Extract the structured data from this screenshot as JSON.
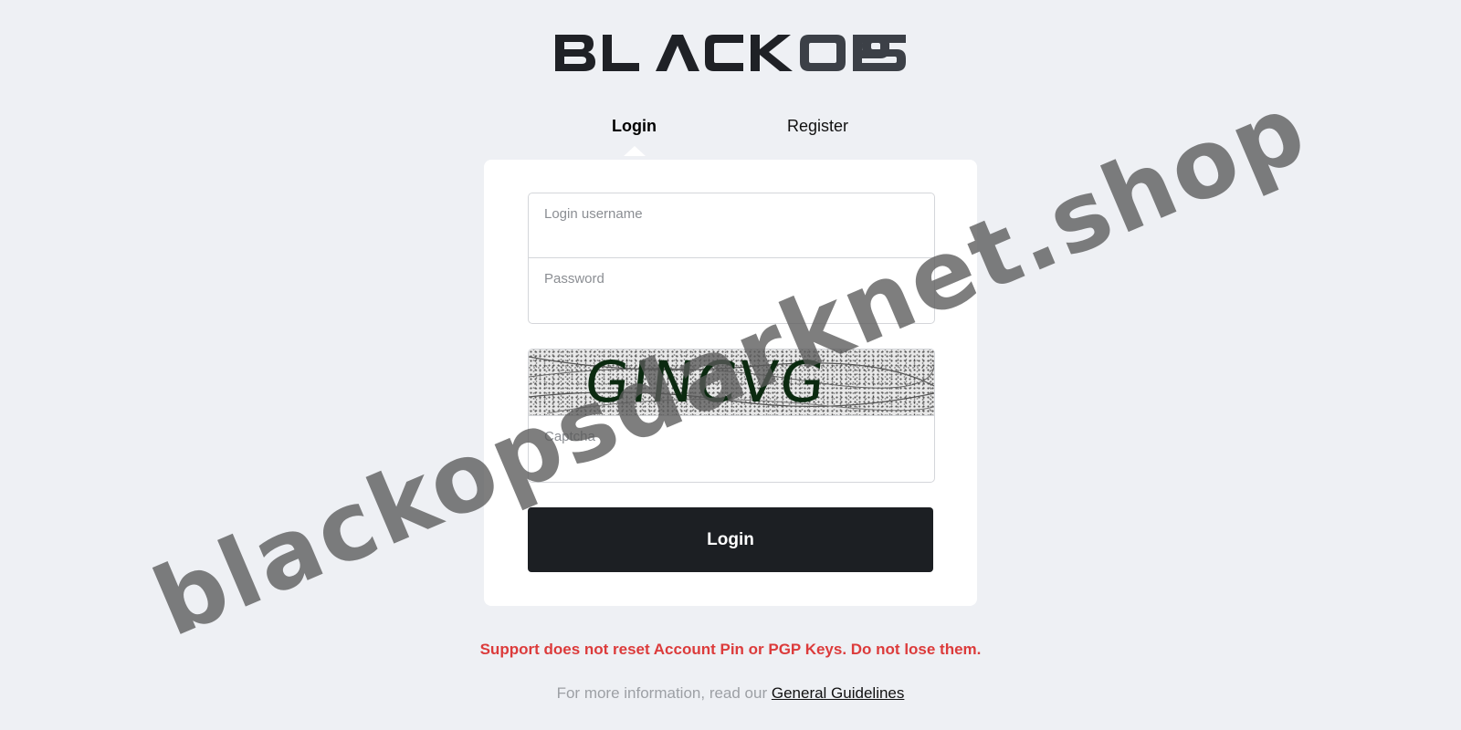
{
  "brand": {
    "name": "BLACK OPS",
    "logo_color": "#2a2c30"
  },
  "tabs": [
    {
      "label": "Login",
      "active": true
    },
    {
      "label": "Register",
      "active": false
    }
  ],
  "form": {
    "username_label": "Login username",
    "username_value": "",
    "password_label": "Password",
    "password_value": "",
    "captcha_image_text": "GINCVG",
    "captcha_label": "Captcha",
    "captcha_value": "",
    "submit_label": "Login"
  },
  "notices": {
    "warning": "Support does not reset Account Pin or PGP Keys. Do not lose them.",
    "info_prefix": "For more information, read our ",
    "info_link": "General Guidelines"
  },
  "watermark": "blackopsdarknet.shop",
  "colors": {
    "background": "#eef0f4",
    "button": "#1c1f23",
    "warning": "#dc3b3b",
    "captcha_text": "#0b2a10"
  }
}
